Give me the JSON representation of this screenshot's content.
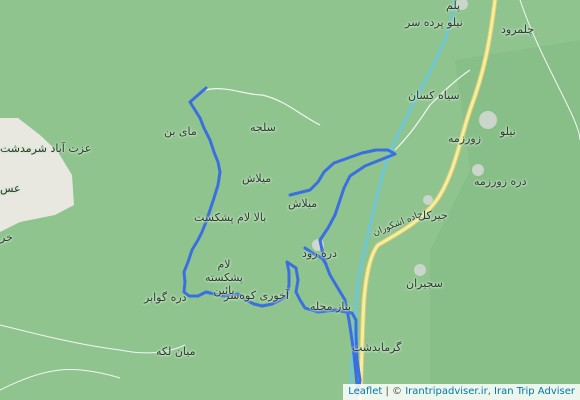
{
  "map": {
    "labels": {
      "chalmarud": "چلمرود",
      "nilo_pardeh_sar": "نیلو پرده سر",
      "palm": "پلم",
      "siah_kesan": "سیاه کسان",
      "nilo": "نیلو",
      "zoorzameh": "زورزمه",
      "dareh_zoorzameh": "دره زورزمه",
      "jirkol": "جیرکل",
      "jadeh_eshkoran": "جاده اشکوران",
      "sajiran": "سجیران",
      "garmabdasht": "گرمابدشت",
      "mai_bon": "مای بن",
      "saleh": "سلجه",
      "ezzatabad": "عزت آباد شرمدشت",
      "milash1": "میلاش",
      "milash2": "میلاش",
      "bala_lam_pashkast": "بالا لام پشکست",
      "lam_pashkast_paein": "لام پشکسته پائین",
      "dereh_govabar": "دره گوابر",
      "akhori_kohsar": "آخوری کوه‌سر",
      "bonaz_mahalleh": "بناز محله",
      "dareh_rud": "دره رود",
      "mian_lakeh": "میان لکه",
      "ashkal_edge": "عس",
      "kh_edge": "خر"
    },
    "route_color": "#3b6fe0",
    "river_color": "#6fc7d6",
    "road_color": "#f3e98e"
  },
  "attribution": {
    "leaflet": "Leaflet",
    "separator": " | © ",
    "site": "Irantripadviser.ir",
    "comma": ", ",
    "name": "Iran Trip Adviser"
  }
}
